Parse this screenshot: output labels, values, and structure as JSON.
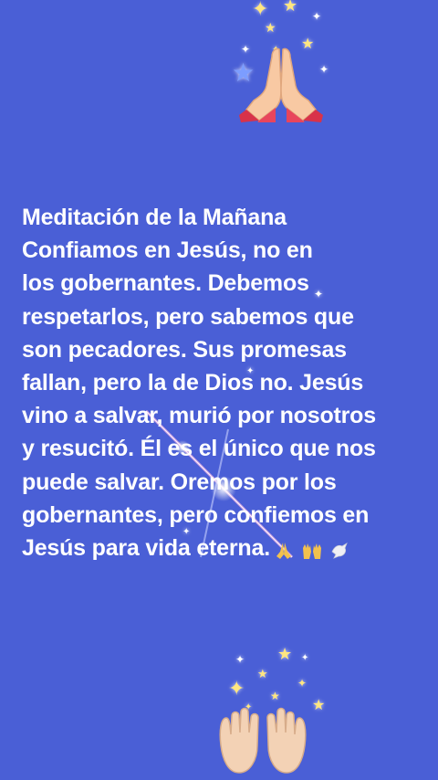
{
  "post": {
    "lines": [
      "Meditación de la Mañana",
      "Confiamos en Jesús, no en",
      "los gobernantes. Debemos",
      "respetarlos, pero sabemos que",
      "son pecadores. Sus promesas",
      "fallan, pero la de Dios no. Jesús",
      "vino a salvar, murió por nosotros",
      "y resucitó. Él es el único que nos",
      "puede salvar. Oremos por los",
      "gobernantes, pero confiemos en",
      "Jesús para vida eterna."
    ],
    "trailing_emojis": [
      "folded-hands-emoji",
      "raised-hands-emoji",
      "dove-emoji"
    ],
    "top_emoji": "folded-hands-emoji",
    "bottom_emoji": "palms-up-together-emoji"
  },
  "theme": {
    "background": "#4a5fd6",
    "text": "#ffffff",
    "sparkle": "#ffe680"
  }
}
